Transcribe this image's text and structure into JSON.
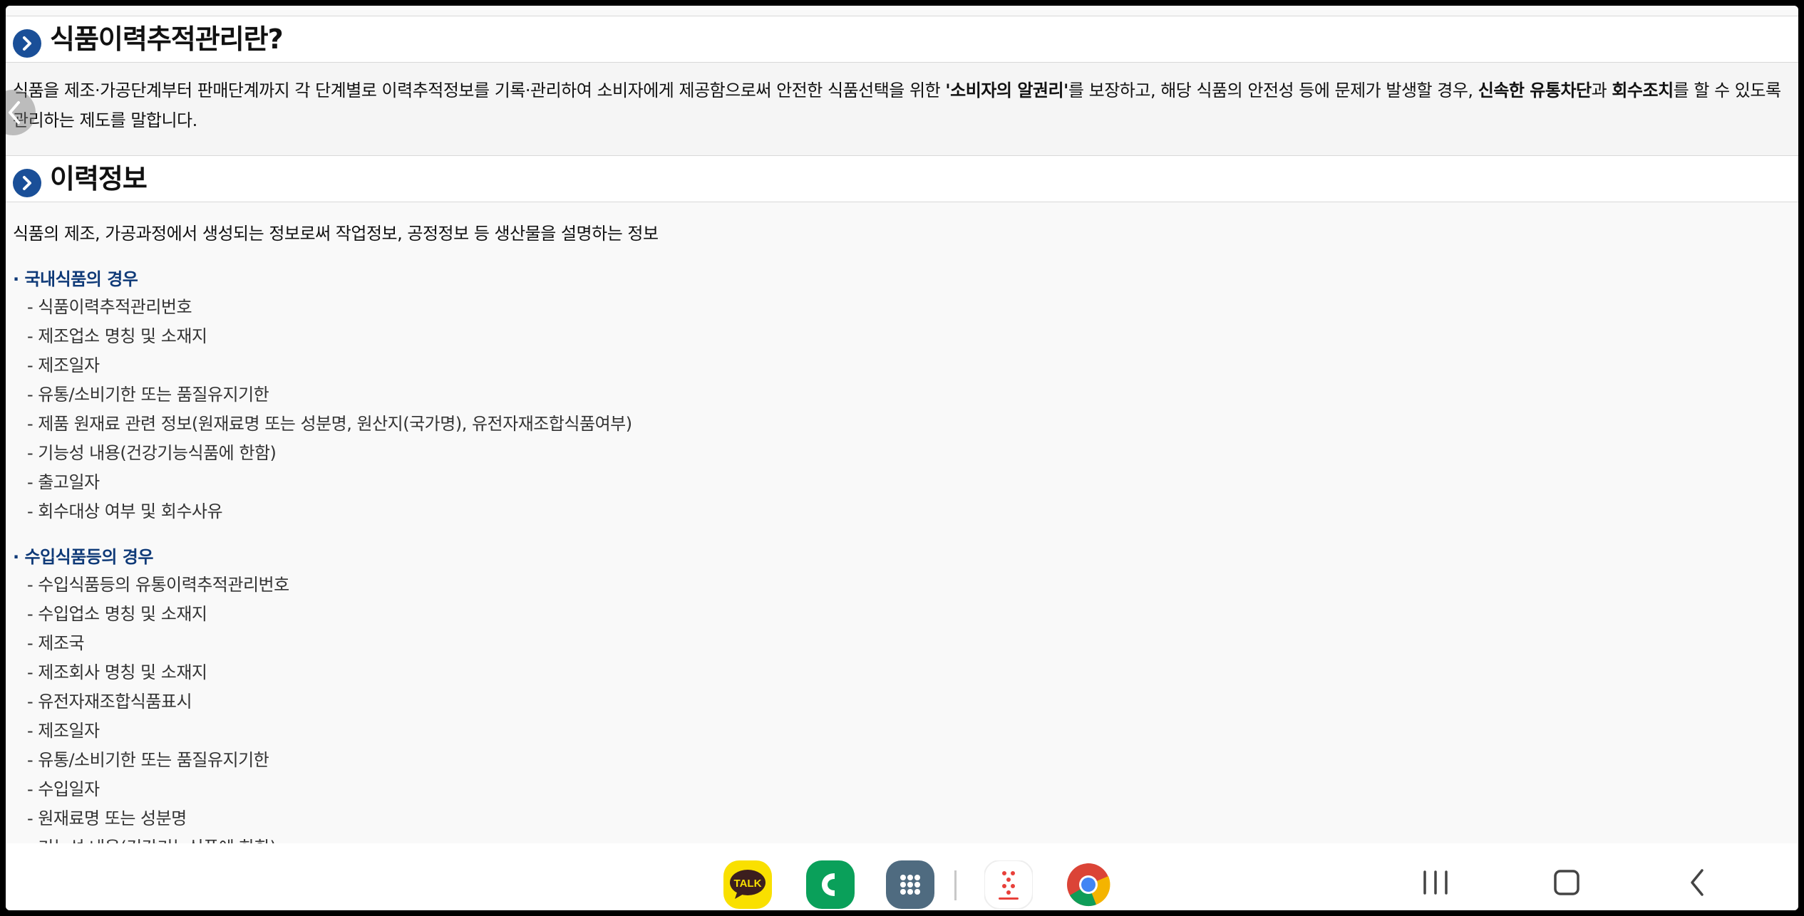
{
  "section1": {
    "title": "식품이력추적관리란?"
  },
  "intro": {
    "part1": "식품을 제조·가공단계부터 판매단계까지 각 단계별로 이력추적정보를 기록·관리하여 소비자에게 제공함으로써 안전한 식품선택을 위한 ",
    "bold1": "'소비자의 알권리'",
    "part2": "를 보장하고, 해당 식품의 안전성 등에 문제가 발생할 경우, ",
    "bold2": "신속한 유통차단",
    "part3": "과 ",
    "bold3": "회수조치",
    "part4": "를 할 수 있도록 관리하는 제도를 말합니다."
  },
  "section2": {
    "title": "이력정보"
  },
  "description": "식품의 제조, 가공과정에서 생성되는 정보로써 작업정보, 공정정보 등 생산물을 설명하는 정보",
  "domestic": {
    "title": "· 국내식품의 경우",
    "items": [
      "- 식품이력추적관리번호",
      "- 제조업소 명칭 및 소재지",
      "- 제조일자",
      "- 유통/소비기한 또는 품질유지기한",
      "- 제품 원재료 관련 정보(원재료명 또는 성분명, 원산지(국가명), 유전자재조합식품여부)",
      "- 기능성 내용(건강기능식품에 한함)",
      "- 출고일자",
      "- 회수대상 여부 및 회수사유"
    ]
  },
  "imported": {
    "title": "· 수입식품등의 경우",
    "items": [
      "- 수입식품등의 유통이력추적관리번호",
      "- 수입업소 명칭 및 소재지",
      "- 제조국",
      "- 제조회사 명칭 및 소재지",
      "- 유전자재조합식품표시",
      "- 제조일자",
      "- 유통/소비기한 또는 품질유지기한",
      "- 수입일자",
      "- 원재료명 또는 성분명",
      "- 기능성 내용(건강기능식품에 한함)"
    ]
  },
  "taskbar": {
    "kakao_label": "TALK",
    "colors": {
      "kakao": "#f9e000",
      "phone": "#0aa05a",
      "apps": "#4f6b80",
      "accent": "#1a4f98"
    }
  }
}
